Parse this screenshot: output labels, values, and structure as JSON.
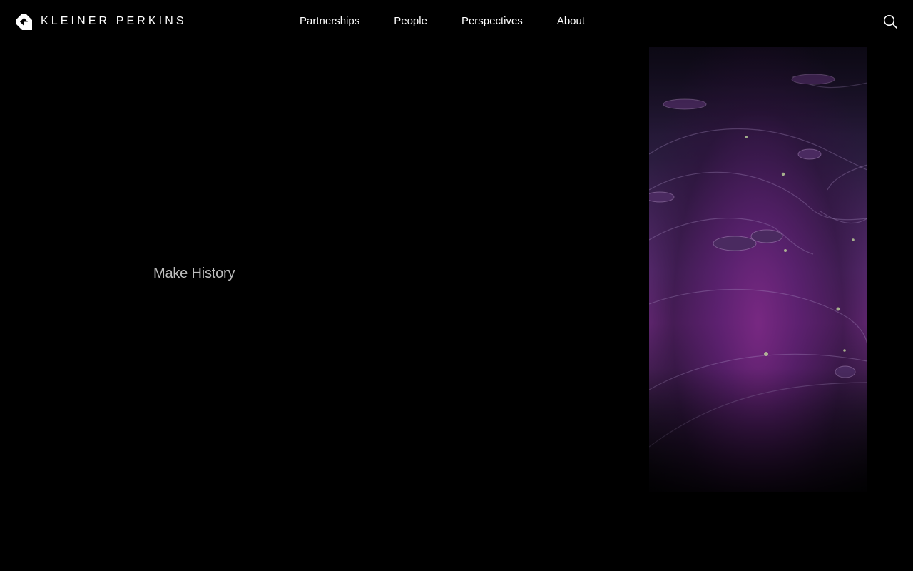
{
  "brand": {
    "name": "KLEINER PERKINS",
    "logo_icon": "kleiner-perkins-mark-icon"
  },
  "nav": {
    "items": [
      {
        "label": "Partnerships"
      },
      {
        "label": "People"
      },
      {
        "label": "Perspectives"
      },
      {
        "label": "About"
      }
    ]
  },
  "search": {
    "icon": "search-icon"
  },
  "hero": {
    "title": "Make History"
  },
  "colors": {
    "background": "#000000",
    "text": "#ffffff",
    "hero_text": "#bdbdbd",
    "accent_purple": "#6a2a7a"
  }
}
